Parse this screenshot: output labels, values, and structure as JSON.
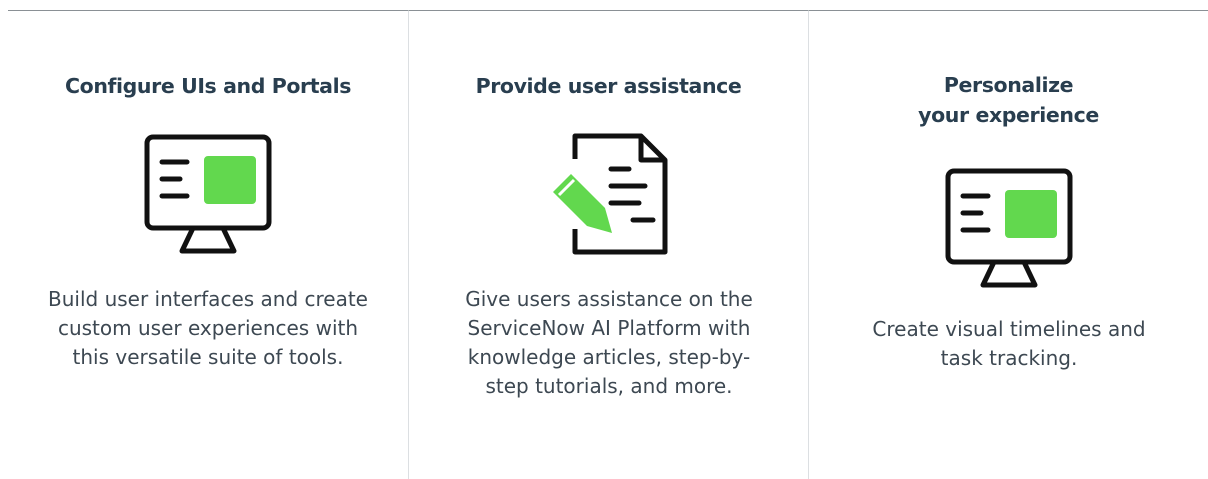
{
  "cards": [
    {
      "title": "Configure UIs and Portals",
      "icon": "monitor-icon",
      "description": "Build user interfaces and create custom user experiences with this versatile suite of tools."
    },
    {
      "title": "Provide user assistance",
      "icon": "document-pencil-icon",
      "description": "Give users assistance on the ServiceNow AI Platform with knowledge articles, step-by-step tutorials, and more."
    },
    {
      "title": "Personalize\nyour experience",
      "icon": "monitor-icon",
      "description": "Create visual timelines and task tracking."
    }
  ],
  "colors": {
    "title": "#293e4f",
    "text": "#3d4852",
    "icon_stroke": "#111111",
    "accent_green": "#62d84e",
    "card_top_border": "#8a9095",
    "divider": "#dcdfe2"
  }
}
